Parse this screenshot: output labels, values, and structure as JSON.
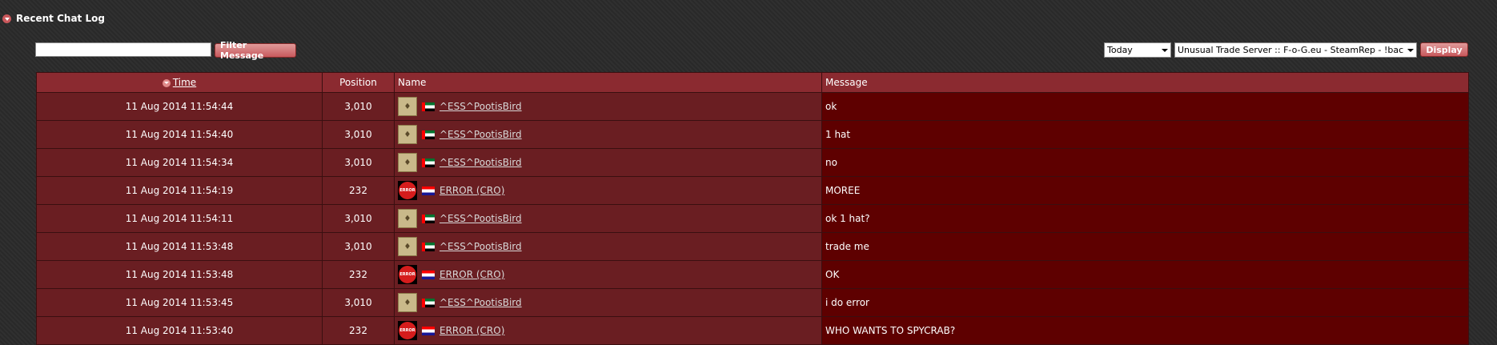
{
  "section": {
    "title": "Recent Chat Log",
    "collapse_icon": "chevron-down-icon"
  },
  "filter": {
    "value": "",
    "placeholder": "",
    "button_label": "Filter Message"
  },
  "date_select": {
    "selected": "Today"
  },
  "server_select": {
    "selected": "Unusual Trade Server :: F-o-G.eu - SteamRep - !backpack"
  },
  "display_button": {
    "label": "Display"
  },
  "table": {
    "headers": {
      "time": "Time",
      "position": "Position",
      "name": "Name",
      "message": "Message"
    },
    "rows": [
      {
        "time": "11 Aug 2014 11:54:44",
        "position": "3,010",
        "name": "^ESS^PootisBird",
        "avatar": "bird",
        "flag": "ae",
        "message": "ok"
      },
      {
        "time": "11 Aug 2014 11:54:40",
        "position": "3,010",
        "name": "^ESS^PootisBird",
        "avatar": "bird",
        "flag": "ae",
        "message": "1 hat"
      },
      {
        "time": "11 Aug 2014 11:54:34",
        "position": "3,010",
        "name": "^ESS^PootisBird",
        "avatar": "bird",
        "flag": "ae",
        "message": "no"
      },
      {
        "time": "11 Aug 2014 11:54:19",
        "position": "232",
        "name": "ERROR (CRO)",
        "avatar": "error",
        "flag": "hr",
        "message": "MOREE"
      },
      {
        "time": "11 Aug 2014 11:54:11",
        "position": "3,010",
        "name": "^ESS^PootisBird",
        "avatar": "bird",
        "flag": "ae",
        "message": "ok 1 hat?"
      },
      {
        "time": "11 Aug 2014 11:53:48",
        "position": "3,010",
        "name": "^ESS^PootisBird",
        "avatar": "bird",
        "flag": "ae",
        "message": "trade me"
      },
      {
        "time": "11 Aug 2014 11:53:48",
        "position": "232",
        "name": "ERROR (CRO)",
        "avatar": "error",
        "flag": "hr",
        "message": "OK"
      },
      {
        "time": "11 Aug 2014 11:53:45",
        "position": "3,010",
        "name": "^ESS^PootisBird",
        "avatar": "bird",
        "flag": "ae",
        "message": "i do error"
      },
      {
        "time": "11 Aug 2014 11:53:40",
        "position": "232",
        "name": "ERROR (CRO)",
        "avatar": "error",
        "flag": "hr",
        "message": "WHO WANTS TO SPYCRAB?"
      }
    ]
  },
  "colors": {
    "header_bg": "#8b2a30",
    "row_bg": "#6a1e22",
    "message_bg": "#5e0000",
    "button_bg": "#c8595d"
  }
}
